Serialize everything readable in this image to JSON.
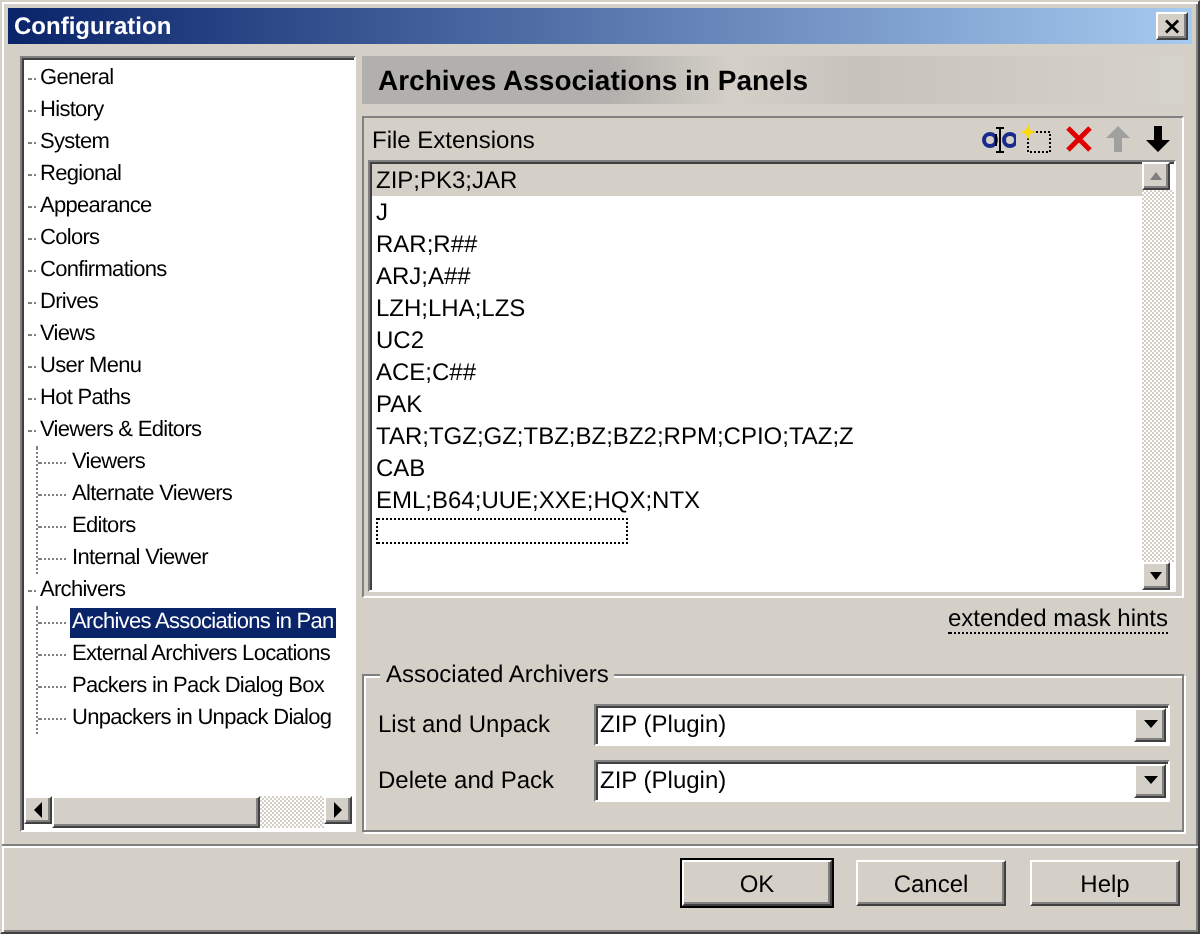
{
  "window": {
    "title": "Configuration",
    "close": "×"
  },
  "tree": [
    {
      "label": "General",
      "selected": false
    },
    {
      "label": "History",
      "selected": false
    },
    {
      "label": "System",
      "selected": false
    },
    {
      "label": "Regional",
      "selected": false
    },
    {
      "label": "Appearance",
      "selected": false
    },
    {
      "label": "Colors",
      "selected": false
    },
    {
      "label": "Confirmations",
      "selected": false
    },
    {
      "label": "Drives",
      "selected": false
    },
    {
      "label": "Views",
      "selected": false
    },
    {
      "label": "User Menu",
      "selected": false
    },
    {
      "label": "Hot Paths",
      "selected": false
    },
    {
      "label": "Viewers & Editors",
      "selected": false,
      "children": [
        {
          "label": "Viewers",
          "selected": false
        },
        {
          "label": "Alternate Viewers",
          "selected": false
        },
        {
          "label": "Editors",
          "selected": false
        },
        {
          "label": "Internal Viewer",
          "selected": false
        }
      ]
    },
    {
      "label": "Archivers",
      "selected": false,
      "children": [
        {
          "label": "Archives Associations in Pan",
          "selected": true
        },
        {
          "label": "External Archivers Locations",
          "selected": false
        },
        {
          "label": "Packers in Pack Dialog Box",
          "selected": false
        },
        {
          "label": "Unpackers in Unpack Dialog",
          "selected": false
        }
      ]
    }
  ],
  "panel_title": "Archives Associations in Panels",
  "extensions": {
    "label": "File Extensions",
    "tools": [
      {
        "kind": "rename",
        "disabled": false
      },
      {
        "kind": "new",
        "disabled": false
      },
      {
        "kind": "delete",
        "disabled": false
      },
      {
        "kind": "up",
        "disabled": true
      },
      {
        "kind": "down",
        "disabled": false
      }
    ],
    "rows": [
      {
        "text": "ZIP;PK3;JAR",
        "selected": true
      },
      {
        "text": "J",
        "selected": false
      },
      {
        "text": "RAR;R##",
        "selected": false
      },
      {
        "text": "ARJ;A##",
        "selected": false
      },
      {
        "text": "LZH;LHA;LZS",
        "selected": false
      },
      {
        "text": "UC2",
        "selected": false
      },
      {
        "text": "ACE;C##",
        "selected": false
      },
      {
        "text": "PAK",
        "selected": false
      },
      {
        "text": "TAR;TGZ;GZ;TBZ;BZ;BZ2;RPM;CPIO;TAZ;Z",
        "selected": false
      },
      {
        "text": "CAB",
        "selected": false
      },
      {
        "text": "EML;B64;UUE;XXE;HQX;NTX",
        "selected": false
      }
    ]
  },
  "hint_link": "extended mask hints",
  "associated": {
    "title": "Associated Archivers",
    "fields": [
      {
        "label": "List and Unpack",
        "value": "ZIP (Plugin)"
      },
      {
        "label": "Delete and Pack",
        "value": "ZIP (Plugin)"
      }
    ]
  },
  "buttons": [
    "OK",
    "Cancel",
    "Help"
  ]
}
